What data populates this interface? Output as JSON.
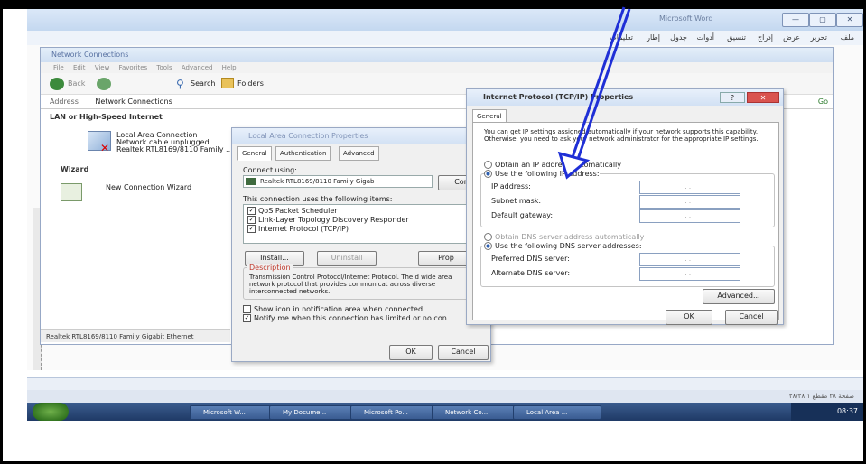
{
  "word": {
    "title": "Microsoft Word",
    "menu": [
      "ملف",
      "تحرير",
      "عرض",
      "إدراج",
      "تنسيق",
      "أدوات",
      "جدول",
      "إطار",
      "تعليمات"
    ],
    "status_text": "صفحة ٢٨   مقطع ١   ٢٨/٢٨"
  },
  "network": {
    "title": "Network Connections",
    "menu": "File  Edit  View  Favorites  Tools  Advanced  Help",
    "toolbar": {
      "back": "Back",
      "search": "Search",
      "folders": "Folders"
    },
    "address_label": "Address",
    "address_value": "Network Connections",
    "go": "Go",
    "section_lan": "LAN or High-Speed Internet",
    "conn_name": "Local Area Connection",
    "conn_status": "Network cable unplugged",
    "conn_device": "Realtek RTL8169/8110 Family ...",
    "section_wizard": "Wizard",
    "wizard_name": "New Connection Wizard",
    "status_bar": "Realtek RTL8169/8110 Family Gigabit Ethernet"
  },
  "lac": {
    "title": "Local Area Connection Properties",
    "tabs": [
      "General",
      "Authentication",
      "Advanced"
    ],
    "connect_using": "Connect using:",
    "adapter": "Realtek RTL8169/8110 Family Gigab",
    "configure": "Con",
    "items_label": "This connection uses the following items:",
    "items": [
      "QoS Packet Scheduler",
      "Link-Layer Topology Discovery Responder",
      "Internet Protocol (TCP/IP)"
    ],
    "install": "Install...",
    "uninstall": "Uninstall",
    "properties": "Prop",
    "desc_title": "Description",
    "desc_text": "Transmission Control Protocol/Internet Protocol. The d wide area network protocol that provides communicat across diverse interconnected networks.",
    "show_icon": "Show icon in notification area when connected",
    "notify": "Notify me when this connection has limited or no con",
    "ok": "OK",
    "cancel": "Cancel"
  },
  "tcp": {
    "title": "Internet Protocol (TCP/IP) Properties",
    "tab": "General",
    "intro": "You can get IP settings assigned automatically if your network supports this capability. Otherwise, you need to ask your network administrator for the appropriate IP settings.",
    "obtain_ip": "Obtain an IP address automatically",
    "use_ip": "Use the following IP address:",
    "ip_address": "IP address:",
    "subnet": "Subnet mask:",
    "gateway": "Default gateway:",
    "obtain_dns": "Obtain DNS server address automatically",
    "use_dns": "Use the following DNS server addresses:",
    "preferred_dns": "Preferred DNS server:",
    "alternate_dns": "Alternate DNS server:",
    "ip_placeholder": ".   .   .",
    "advanced": "Advanced...",
    "ok": "OK",
    "cancel": "Cancel"
  },
  "taskbar": {
    "items": [
      "Microsoft W...",
      "My Docume...",
      "Microsoft Po...",
      "Network Co...",
      "Local Area ..."
    ],
    "clock": "08:37"
  },
  "colors": {
    "arrow": "#1f2fd6",
    "accent": "#2a5db0",
    "close": "#d9534f"
  }
}
